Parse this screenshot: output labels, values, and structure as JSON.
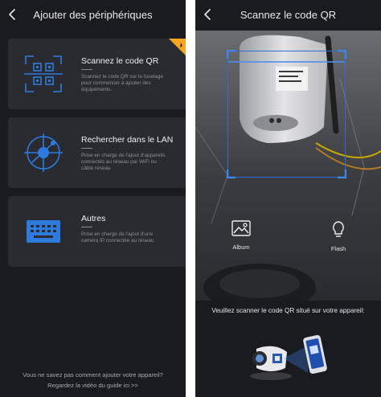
{
  "left_screen": {
    "header": {
      "title": "Ajouter des périphériques",
      "back_icon": "chevron-left-icon"
    },
    "options": [
      {
        "title": "Scannez le code QR",
        "description": "Scannez le code QR sur le fuselage pour commencer à ajouter des équipements.",
        "icon": "qr-scan-icon"
      },
      {
        "title": "Rechercher dans le LAN",
        "description": "Prise en charge de l'ajout d'appareils connectés au réseau par WiFi ou câble réseau",
        "icon": "lan-search-icon"
      },
      {
        "title": "Autres",
        "description": "Prise en charge de l'ajout d'une caméra IP connectée au réseau",
        "icon": "keyboard-icon"
      }
    ],
    "footer": {
      "line1": "Vous ne savez pas comment ajouter votre appareil?",
      "line2": "Regardez la vidéo du guide ici >>"
    }
  },
  "right_screen": {
    "header": {
      "title": "Scannez le code QR",
      "back_icon": "chevron-left-icon"
    },
    "tools": {
      "album_label": "Album",
      "flash_label": "Flash"
    },
    "instruction": "Veuillez scanner le code QR situé sur votre appareil:"
  },
  "colors": {
    "background": "#1a1b1f",
    "card": "#2a2b30",
    "accent_blue": "#2e6fd6",
    "badge_orange": "#f5a623",
    "text_secondary": "#8e8f94"
  }
}
